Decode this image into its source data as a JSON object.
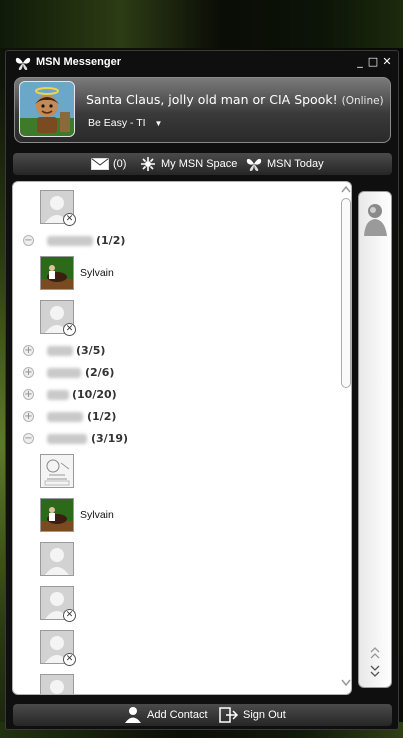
{
  "window": {
    "title": "MSN Messenger",
    "controls": {
      "minimize": "_",
      "maximize": "□",
      "close": "✕"
    }
  },
  "profile": {
    "display_name": "Santa Claus, jolly old man or CIA Spook!",
    "status": "(Online)",
    "personal_message": "Be Easy - TI",
    "avatar_icon": "cartoon-avatar-icon"
  },
  "toolbar": {
    "mail_count": "(0)",
    "my_space_label": "My MSN Space",
    "today_label": "MSN Today"
  },
  "contact_list": {
    "groups": [
      {
        "count": "(1/2)",
        "expanded": true
      },
      {
        "count": "(3/5)",
        "expanded": false
      },
      {
        "count": "(2/6)",
        "expanded": false
      },
      {
        "count": "(10/20)",
        "expanded": false
      },
      {
        "count": "(1/2)",
        "expanded": false
      },
      {
        "count": "(3/19)",
        "expanded": true
      }
    ],
    "contacts": [
      {
        "name": "",
        "picture": "default-blocked"
      },
      {
        "name": "Sylvain",
        "picture": "photo"
      },
      {
        "name": "",
        "picture": "default-blocked"
      },
      {
        "name": "",
        "picture": "sketch"
      },
      {
        "name": "Sylvain",
        "picture": "photo"
      },
      {
        "name": "",
        "picture": "default"
      },
      {
        "name": "",
        "picture": "default-blocked"
      },
      {
        "name": "",
        "picture": "default-blocked"
      },
      {
        "name": "",
        "picture": "default"
      }
    ]
  },
  "bottom_bar": {
    "add_contact_label": "Add Contact",
    "sign_out_label": "Sign Out"
  },
  "colors": {
    "window_bg": "#0f0f0f",
    "profile_panel": "#5a5a5a",
    "list_bg": "#ffffff",
    "desktop_accent": "#5c7a2a"
  }
}
